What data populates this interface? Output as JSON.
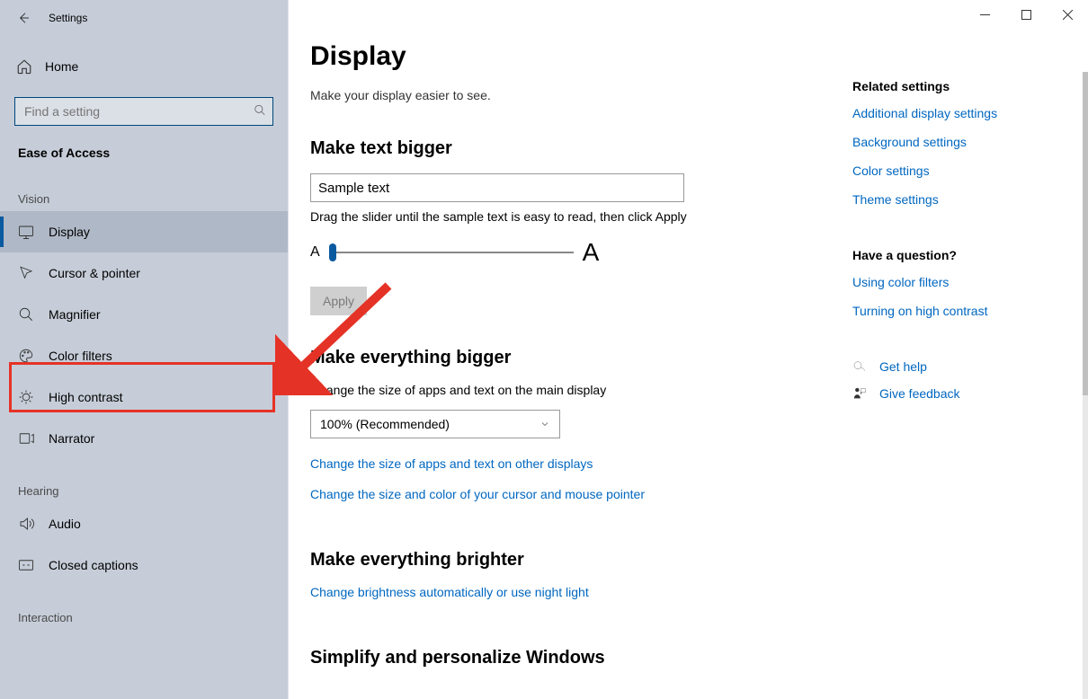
{
  "window": {
    "title": "Settings"
  },
  "home_label": "Home",
  "search_placeholder": "Find a setting",
  "category": "Ease of Access",
  "groups": {
    "vision": {
      "label": "Vision",
      "items": [
        {
          "icon": "display",
          "label": "Display"
        },
        {
          "icon": "cursor",
          "label": "Cursor & pointer"
        },
        {
          "icon": "magnifier",
          "label": "Magnifier"
        },
        {
          "icon": "color-filters",
          "label": "Color filters"
        },
        {
          "icon": "high-contrast",
          "label": "High contrast"
        },
        {
          "icon": "narrator",
          "label": "Narrator"
        }
      ]
    },
    "hearing": {
      "label": "Hearing",
      "items": [
        {
          "icon": "audio",
          "label": "Audio"
        },
        {
          "icon": "captions",
          "label": "Closed captions"
        }
      ]
    },
    "interaction": {
      "label": "Interaction"
    }
  },
  "page": {
    "title": "Display",
    "subtitle": "Make your display easier to see.",
    "text_bigger": {
      "heading": "Make text bigger",
      "sample": "Sample text",
      "help": "Drag the slider until the sample text is easy to read, then click Apply",
      "small_a": "A",
      "big_a": "A",
      "apply": "Apply"
    },
    "everything_bigger": {
      "heading": "Make everything bigger",
      "desc": "Change the size of apps and text on the main display",
      "dropdown_value": "100% (Recommended)",
      "link1": "Change the size of apps and text on other displays",
      "link2": "Change the size and color of your cursor and mouse pointer"
    },
    "brighter": {
      "heading": "Make everything brighter",
      "link": "Change brightness automatically or use night light"
    },
    "simplify": {
      "heading": "Simplify and personalize Windows"
    }
  },
  "rail": {
    "related": "Related settings",
    "links": [
      "Additional display settings",
      "Background settings",
      "Color settings",
      "Theme settings"
    ],
    "question": "Have a question?",
    "qlinks": [
      "Using color filters",
      "Turning on high contrast"
    ],
    "help": "Get help",
    "feedback": "Give feedback"
  }
}
